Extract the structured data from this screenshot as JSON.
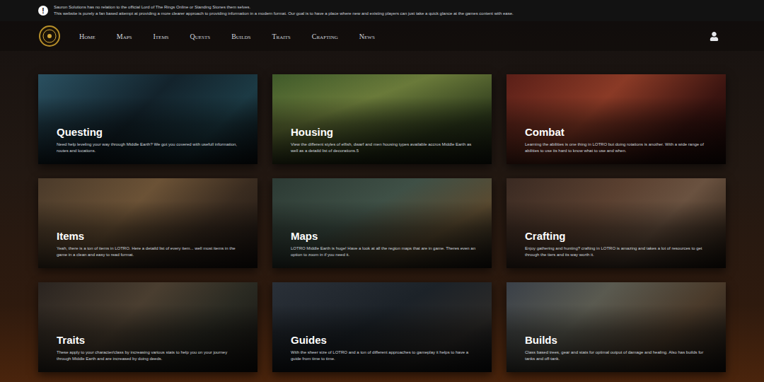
{
  "banner": {
    "icon": "!",
    "lines": [
      "Sauron Solutions has no relation to the official Lord of The Rings Online or Standing Stones them selves.",
      "This website is purely a fan based attempt at providing a more clearer approach to providing information in a modern format. Our goal is to have a place where new and existing players can just take a quick glance at the games content with ease."
    ]
  },
  "nav": {
    "items": [
      "Home",
      "Maps",
      "Items",
      "Quests",
      "Builds",
      "Traits",
      "Crafting",
      "News"
    ]
  },
  "cards": [
    {
      "title": "Questing",
      "description": "Need help leveling your way through Middle Earth? We got you covered with usefull information, routes and locations."
    },
    {
      "title": "Housing",
      "description": "View the different styles of elfish, dwarf and men housing types available accros Middle Earth as well as a detaild list of decorations.5"
    },
    {
      "title": "Combat",
      "description": "Learning the abilities is one thing in LOTRO but doing rotations is another. With a wide range of abilities to use its hard to know what to use and when."
    },
    {
      "title": "Items",
      "description": "Yeah, there is a ton of items in LOTRO. Here a detaild list of every item... well most items in the game in a clean and easy to read format."
    },
    {
      "title": "Maps",
      "description": "LOTRO Middle Earth is huge! Have a look at all the region maps that are in game. Theres even an option to zoom in if you need it."
    },
    {
      "title": "Crafting",
      "description": "Enjoy gathering and hunting? crafting in LOTRO is amazing and takes a lot of resources to get through the tiers and its way worth it."
    },
    {
      "title": "Traits",
      "description": "These apply to your character/class by increasing various stats to help you on your journey through Middle Earth and are increased by doing deeds."
    },
    {
      "title": "Guides",
      "description": "With the sheer size of LOTRO and a ton of different approaches to gameplay it helps to have a guide from time to time."
    },
    {
      "title": "Builds",
      "description": "Class based trees, gear and stats for optimal output of damage and healing. Also has builds for tanks and off-tank."
    }
  ]
}
